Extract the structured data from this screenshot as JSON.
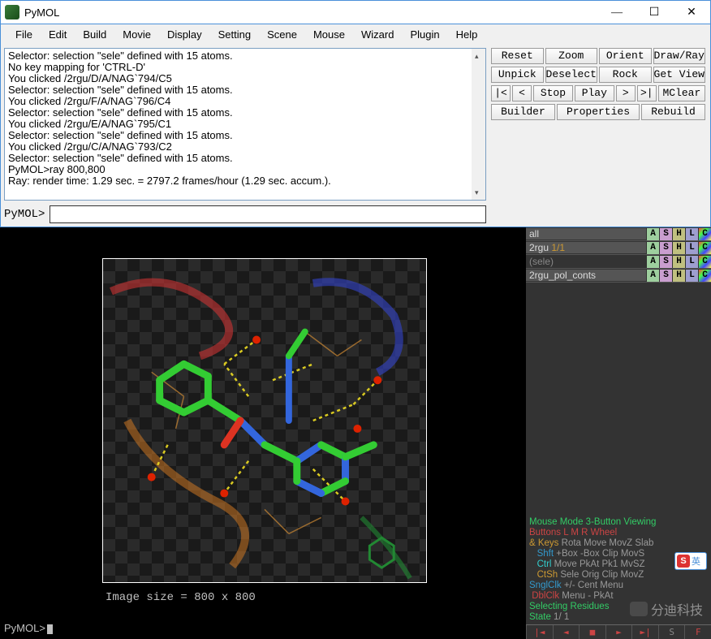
{
  "window": {
    "title": "PyMOL"
  },
  "menubar": [
    "File",
    "Edit",
    "Build",
    "Movie",
    "Display",
    "Setting",
    "Scene",
    "Mouse",
    "Wizard",
    "Plugin",
    "Help"
  ],
  "console_lines": [
    " Selector: selection \"sele\" defined with 15 atoms.",
    " No key mapping for 'CTRL-D'",
    " You clicked /2rgu/D/A/NAG`794/C5",
    " Selector: selection \"sele\" defined with 15 atoms.",
    " You clicked /2rgu/F/A/NAG`796/C4",
    " Selector: selection \"sele\" defined with 15 atoms.",
    " You clicked /2rgu/E/A/NAG`795/C1",
    " Selector: selection \"sele\" defined with 15 atoms.",
    " You clicked /2rgu/C/A/NAG`793/C2",
    " Selector: selection \"sele\" defined with 15 atoms.",
    "PyMOL>ray 800,800",
    " Ray: render time: 1.29 sec. = 2797.2 frames/hour (1.29 sec. accum.)."
  ],
  "prompt": {
    "label": "PyMOL>",
    "value": ""
  },
  "toolbar": {
    "row1": [
      "Reset",
      "Zoom",
      "Orient",
      "Draw/Ray"
    ],
    "row2": [
      "Unpick",
      "Deselect",
      "Rock",
      "Get View"
    ],
    "row3_arrows_a": [
      "|<",
      "<"
    ],
    "row3_mid": [
      "Stop",
      "Play"
    ],
    "row3_arrows_b": [
      ">",
      ">|"
    ],
    "row3_end": "MClear",
    "row4": [
      "Builder",
      "Properties",
      "Rebuild"
    ]
  },
  "objects": [
    {
      "name": "all",
      "fraction": "",
      "mode": "active"
    },
    {
      "name": "2rgu",
      "fraction": "1/1",
      "mode": "active"
    },
    {
      "name": "(sele)",
      "fraction": "",
      "mode": "inactive"
    },
    {
      "name": "2rgu_pol_conts",
      "fraction": "",
      "mode": "active"
    }
  ],
  "image_size_label": "Image size = 800 x 800",
  "bottom_prompt": "PyMOL>",
  "mouse_info": {
    "mode": "Mouse Mode 3-Button Viewing",
    "buttons_l": "Buttons",
    "b_cols": " L    M    R  Wheel",
    "keys_l": "& Keys",
    "keys_v": " Rota Move MovZ Slab",
    "shft_l": "Shft",
    "shft_v": " +Box -Box Clip MovS",
    "ctrl_l": "Ctrl",
    "ctrl_v": " Move PkAt Pk1  MvSZ",
    "ctsh_l": "CtSh",
    "ctsh_v": " Sele Orig Clip MovZ",
    "sngl_l": "SnglClk",
    "sngl_v": " +/-  Cent Menu",
    "dbl_l": "DblClk",
    "dbl_v": " Menu  -   PkAt",
    "sel_l": "Selecting",
    "sel_v": " Residues",
    "state_l": "State",
    "state_v": " 1/ 1"
  },
  "playback": [
    "|◄",
    "◄",
    "■",
    "►",
    "►|",
    "S",
    "F"
  ],
  "watermark": "分迪科技",
  "ime": {
    "s": "S",
    "t": "英"
  }
}
